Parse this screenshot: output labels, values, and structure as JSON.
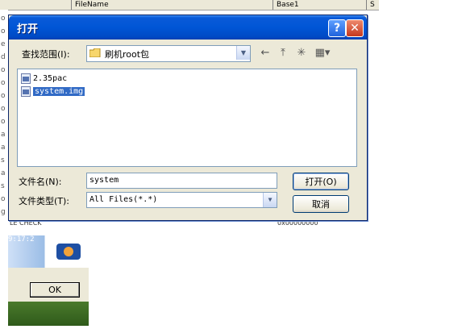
{
  "background": {
    "columns": [
      "FileName",
      "Base1",
      "S"
    ],
    "row_texts": [
      "LE CHECK",
      "0x00000000"
    ],
    "time_text": "9:17:2",
    "ok_label": "OK",
    "left_marks": [
      "o",
      "o",
      "e",
      "d",
      "o",
      "o",
      "o",
      "o",
      "o",
      "a",
      "a",
      "s",
      "a",
      "s",
      "o",
      "g"
    ]
  },
  "dialog": {
    "title": "打开",
    "help_glyph": "?",
    "close_glyph": "✕",
    "look_in_label": "查找范围(I):",
    "look_in_value": "刷机root包",
    "toolbar": {
      "back_icon": "←",
      "up_icon": "⤒",
      "new_folder_icon": "✳",
      "view_icon": "▦▾"
    },
    "files": [
      {
        "name": "2.35pac",
        "selected": false
      },
      {
        "name": "system.img",
        "selected": true
      }
    ],
    "file_name_label": "文件名(N):",
    "file_name_value": "system",
    "file_type_label": "文件类型(T):",
    "file_type_value": "All Files(*.*)",
    "open_button": "打开(O)",
    "cancel_button": "取消"
  },
  "colors": {
    "title_bar": "#0056d6",
    "selection": "#316ac5",
    "dialog_bg": "#ece9d8"
  }
}
